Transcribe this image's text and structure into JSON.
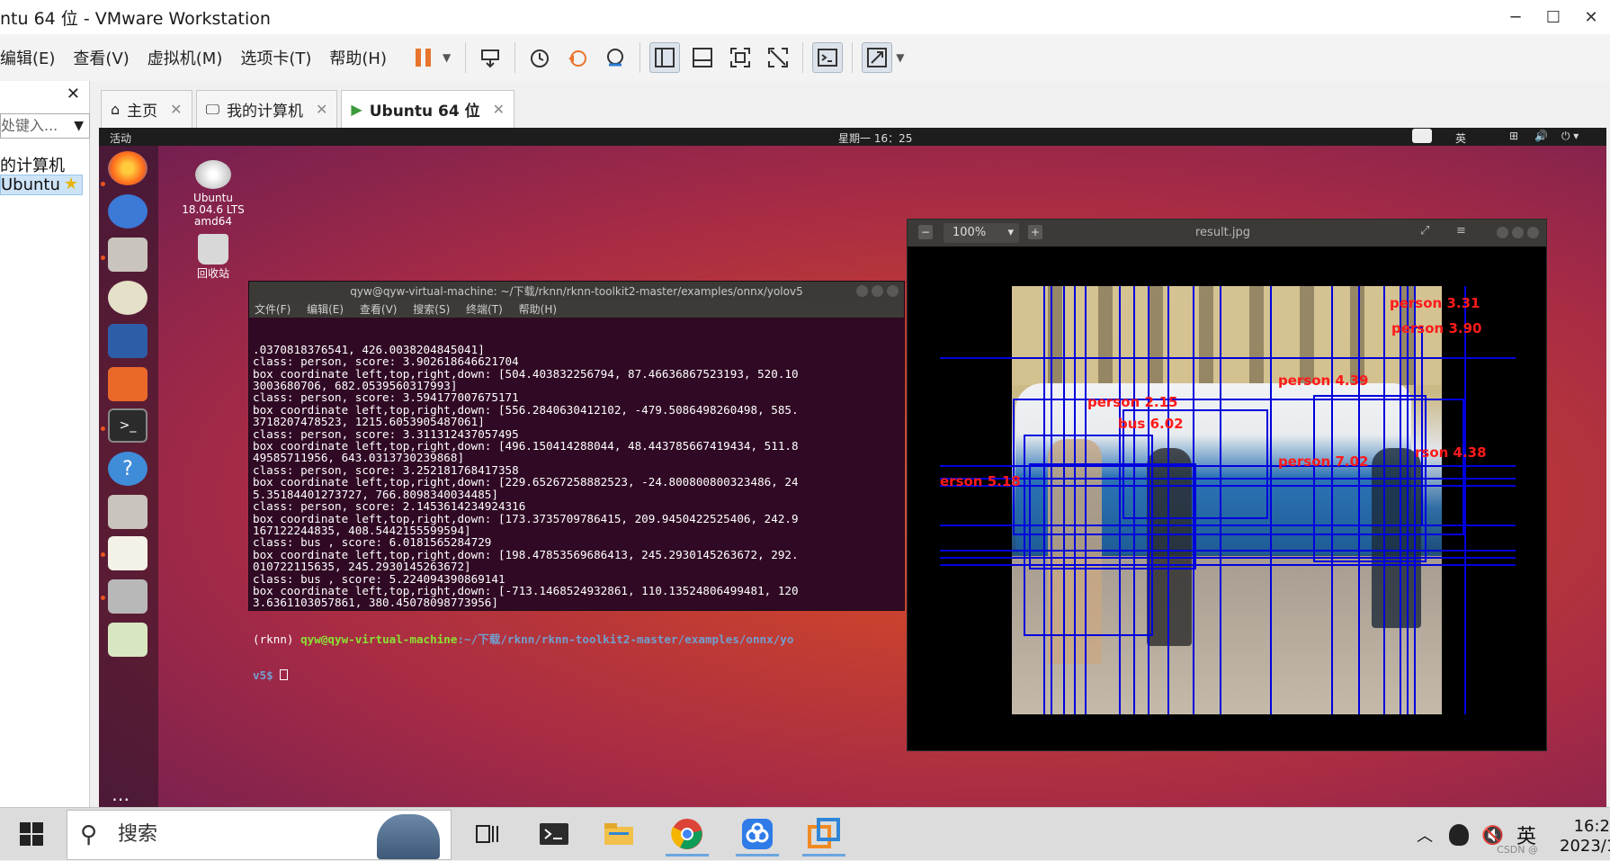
{
  "window": {
    "title": "ntu 64 位 - VMware Workstation",
    "controls": [
      "─",
      "☐",
      "✕"
    ]
  },
  "menubar": {
    "items": [
      "编辑(E)",
      "查看(V)",
      "虚拟机(M)",
      "选项卡(T)",
      "帮助(H)"
    ]
  },
  "library": {
    "close": "✕",
    "search_placeholder": "处键入...",
    "items": [
      "的计算机",
      "Ubuntu"
    ]
  },
  "tabs": [
    {
      "label": "主页",
      "icon": "home-icon"
    },
    {
      "label": "我的计算机",
      "icon": "monitor-icon"
    },
    {
      "label": "Ubuntu 64 位",
      "icon": "vm-icon"
    }
  ],
  "ubuntu": {
    "activities": "活动",
    "clock": "星期一 16：25",
    "input_method": "英",
    "desktop_icons": [
      {
        "label": "Ubuntu 18.04.6 LTS amd64",
        "icon": "dvd-icon"
      },
      {
        "label": "回收站",
        "icon": "trash-icon"
      }
    ]
  },
  "terminal": {
    "title": "qyw@qyw-virtual-machine: ~/下载/rknn/rknn-toolkit2-master/examples/onnx/yolov5",
    "menu": [
      "文件(F)",
      "编辑(E)",
      "查看(V)",
      "搜索(S)",
      "终端(T)",
      "帮助(H)"
    ],
    "lines": [
      ".0370818376541, 426.0038204845041]",
      "class: person, score: 3.902618646621704",
      "box coordinate left,top,right,down: [504.403832256794, 87.46636867523193, 520.10",
      "3003680706, 682.0539560317993]",
      "class: person, score: 3.594177007675171",
      "box coordinate left,top,right,down: [556.2840630412102, -479.5086498260498, 585.",
      "3718207478523, 1215.6053905487061]",
      "class: person, score: 3.311312437057495",
      "box coordinate left,top,right,down: [496.150414288044, 48.443785667419434, 511.8",
      "49585711956, 643.0313730239868]",
      "class: person, score: 3.252181768417358",
      "box coordinate left,top,right,down: [229.65267258882523, -24.800800800323486, 24",
      "5.35184401273727, 766.8098340034485]",
      "class: person, score: 2.1453614234924316",
      "box coordinate left,top,right,down: [173.3735709786415, 209.9450422525406, 242.9",
      "167122244835, 408.5442155599594]",
      "class: bus , score: 6.0181565284729",
      "box coordinate left,top,right,down: [198.47853569686413, 245.2930145263672, 292.",
      "010722115635, 245.2930145263672]",
      "class: bus , score: 5.224094390869141",
      "box coordinate left,top,right,down: [-713.1468524932861, 110.13524806499481, 120",
      "3.6361103057861, 380.45078098773956]"
    ],
    "prompt_env": "(rknn) ",
    "prompt_user": "qyw@qyw-virtual-machine",
    "prompt_path": ":~/下载/rknn/rknn-toolkit2-master/examples/onnx/yo",
    "prompt_tail": "v5$ "
  },
  "viewer": {
    "zoom": "100%",
    "title": "result.jpg",
    "labels": [
      {
        "text": "person 3.31"
      },
      {
        "text": "person 3.90"
      },
      {
        "text": "person 4.39"
      },
      {
        "text": "person 2.15"
      },
      {
        "text": "bus 6.02"
      },
      {
        "text": "person 7.02"
      },
      {
        "text": "rson 4.38"
      },
      {
        "text": "erson 5.18"
      }
    ]
  },
  "taskbar": {
    "search": "搜索",
    "tray_ime": "英",
    "time": "16:2",
    "date": "2023/1",
    "watermark": "CSDN @"
  },
  "colors": {
    "ubuntu_orange": "#e95420",
    "box_blue": "#0000dd",
    "label_red": "#ff1a1a",
    "pause_orange": "#e8742c"
  }
}
